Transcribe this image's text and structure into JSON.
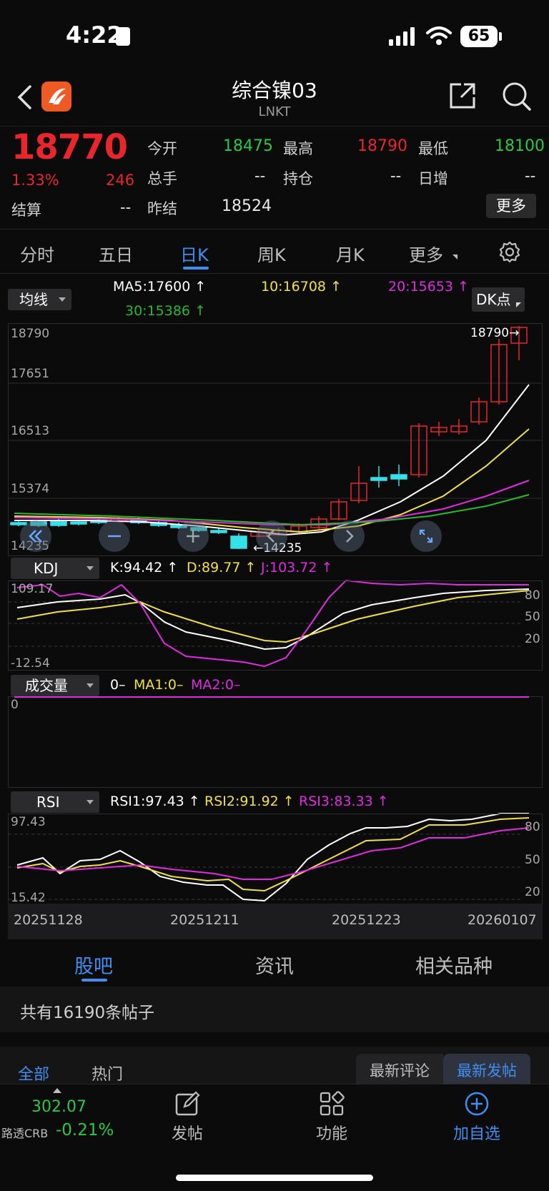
{
  "status": {
    "time": "4:22",
    "battery": "65"
  },
  "header": {
    "title": "综合镍03",
    "subtitle": "LNKT"
  },
  "quote": {
    "price": "18770",
    "change_pct": "1.33%",
    "change": "246",
    "settle_label": "结算",
    "settle": "--",
    "prev_settle_label": "昨结",
    "prev_settle": "18524",
    "open_label": "今开",
    "open": "18475",
    "high_label": "最高",
    "high": "18790",
    "low_label": "最低",
    "low": "18100",
    "volume_label": "总手",
    "volume": "--",
    "position_label": "持仓",
    "position": "--",
    "daily_inc_label": "日增",
    "daily_inc": "--",
    "more_label": "更多"
  },
  "tabs": [
    "分时",
    "五日",
    "日K",
    "周K",
    "月K",
    "更多"
  ],
  "ma": {
    "selector": "均线",
    "ma5": "MA5:17600",
    "ma10": "10:16708",
    "ma20": "20:15653",
    "ma30": "30:15386",
    "dk": "DK点",
    "colors": {
      "ma5": "#ffffff",
      "ma10": "#f1e045",
      "ma20": "#e02ce0",
      "ma30": "#2bb82b"
    }
  },
  "kline": {
    "y_labels": [
      "18790",
      "17651",
      "16513",
      "15374",
      "14235"
    ],
    "high_marker": "18790",
    "low_marker": "14235"
  },
  "kdj": {
    "selector": "KDJ",
    "k": "K:94.42",
    "d": "D:89.77",
    "j": "J:103.72",
    "y_top": "109.17",
    "y_bottom": "-12.54",
    "levels": [
      "80",
      "50",
      "20"
    ]
  },
  "volume": {
    "selector": "成交量",
    "value": "0",
    "ma1": "MA1:0",
    "ma2": "MA2:0",
    "y_label": "0"
  },
  "rsi": {
    "selector": "RSI",
    "rsi1": "RSI1:97.43",
    "rsi2": "RSI2:91.92",
    "rsi3": "RSI3:83.33",
    "y_top": "97.43",
    "y_bottom": "15.42",
    "levels": [
      "80",
      "50",
      "20"
    ]
  },
  "dates": [
    "20251128",
    "20251211",
    "20251223",
    "20260107"
  ],
  "bottom_tabs": [
    "股吧",
    "资讯",
    "相关品种"
  ],
  "post_count": "共有16190条帖子",
  "filters": {
    "all": "全部",
    "hot": "热门",
    "latest_comment": "最新评论",
    "latest_post": "最新发帖"
  },
  "nav": {
    "index_value": "302.07",
    "index_name": "路透CRB",
    "index_change": "-0.21%",
    "post": "发帖",
    "functions": "功能",
    "add_watch": "加自选"
  }
}
